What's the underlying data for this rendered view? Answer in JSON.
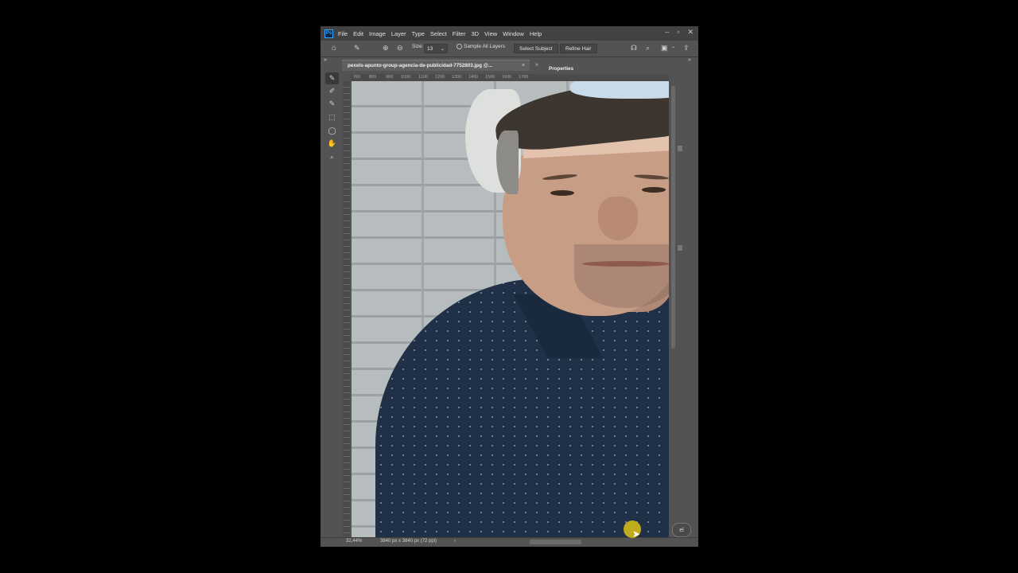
{
  "menu": {
    "app_icon": "Ps",
    "items": [
      "File",
      "Edit",
      "Image",
      "Layer",
      "Type",
      "Select",
      "Filter",
      "3D",
      "View",
      "Window",
      "Help"
    ],
    "window_controls": [
      "–",
      "▫",
      "✕"
    ]
  },
  "options_bar": {
    "size_label": "Size:",
    "size_value": "13",
    "sample_all_layers": "Sample All Layers",
    "select_subject": "Select Subject",
    "refine_hair": "Refine Hair"
  },
  "document": {
    "tab_title": "pexels-apunto-group-agencia-de-publicidad-7752803.jpg @...",
    "close": "×",
    "panel_collapse": "»",
    "properties_tab": "Properties"
  },
  "ruler": {
    "top_ticks": [
      "700",
      "800",
      "900",
      "1000",
      "1100",
      "1200",
      "1300",
      "1400",
      "1500",
      "1600",
      "1700"
    ]
  },
  "tools": [
    {
      "name": "quick-selection-icon",
      "glyph": "✎"
    },
    {
      "name": "refine-edge-brush-icon",
      "glyph": "✐"
    },
    {
      "name": "brush-icon",
      "glyph": "✎"
    },
    {
      "name": "object-selection-icon",
      "glyph": "⬚"
    },
    {
      "name": "lasso-icon",
      "glyph": "◯"
    },
    {
      "name": "hand-icon",
      "glyph": "✋"
    },
    {
      "name": "zoom-icon",
      "glyph": "🔍"
    }
  ],
  "status": {
    "zoom": "32,44%",
    "dimensions": "3840 px x 3840 px (72 ppi)",
    "arrow": "›"
  },
  "dialog": {
    "cancel_partial": "el"
  },
  "colors": {
    "accent": "#31a8ff",
    "cursor_highlight": "#c9b21a"
  }
}
